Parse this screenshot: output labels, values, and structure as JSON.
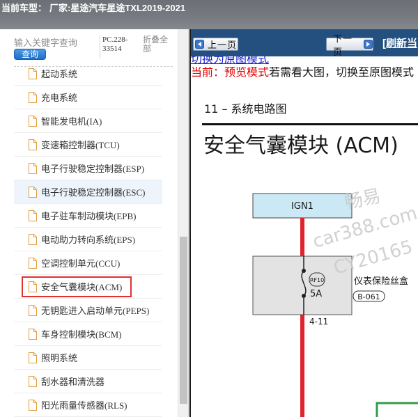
{
  "header": {
    "label": "当前车型：",
    "vehicle": "厂家:星途汽车星途TXL2019-2021"
  },
  "sidebar": {
    "search": {
      "placeholder": "输入关键字查询",
      "button": "查询"
    },
    "code": "PC.228-33514",
    "collapse_all": "折叠全部",
    "items": [
      {
        "label": "起动系统"
      },
      {
        "label": "充电系统"
      },
      {
        "label": "智能发电机(IA)"
      },
      {
        "label": "变速箱控制器(TCU)"
      },
      {
        "label": "电子行驶稳定控制器(ESP)"
      },
      {
        "label": "电子行驶稳定控制器(ESC)",
        "hovered": true
      },
      {
        "label": "电子驻车制动模块(EPB)"
      },
      {
        "label": "电动助力转向系统(EPS)"
      },
      {
        "label": "空调控制单元(CCU)"
      },
      {
        "label": "安全气囊模块(ACM)",
        "selected": true
      },
      {
        "label": "无钥匙进入启动单元(PEPS)"
      },
      {
        "label": "车身控制模块(BCM)"
      },
      {
        "label": "照明系统"
      },
      {
        "label": "刮水器和清洗器"
      },
      {
        "label": "阳光雨量传感器(RLS)"
      }
    ],
    "scroll": {
      "scrolled_percent": 94,
      "visible_percent": 43
    }
  },
  "viewer": {
    "toolbar": {
      "prev": "上一页",
      "next": "下一页",
      "refresh": "[刷新当"
    },
    "mode_link": "切换为原图模式",
    "status": {
      "current": "当前：预览模式",
      "hint": "若需看大图，切换至原图模式"
    },
    "diagram": {
      "section": "11 – 系统电路图",
      "title": "安全气囊模块 (ACM)",
      "power_source": "IGN1",
      "fuse": {
        "id": "RF10",
        "rating": "5A"
      },
      "fuse_box": "仪表保险丝盒",
      "connector": "B-061",
      "pin": "4-11",
      "watermark": [
        "畅易",
        "car388.com",
        "CY20165"
      ]
    }
  },
  "icons": {
    "tree_item": "document-icon",
    "prev": "arrow-left-icon",
    "next": "arrow-right-icon"
  },
  "colors": {
    "header_bg": "#777b81",
    "toolbar_bg": "#24507f",
    "hover_bg": "#edf4fb",
    "selection_outline": "#e0302e",
    "status_red": "#e00000",
    "link_blue": "#1a1ad0",
    "wire_red": "#e0242c",
    "ign_fill": "#cbe8f5",
    "fuse_fill": "#e3e3e3",
    "doc_icon": "#e49b3e",
    "connector_green": "#2e9e4a"
  }
}
